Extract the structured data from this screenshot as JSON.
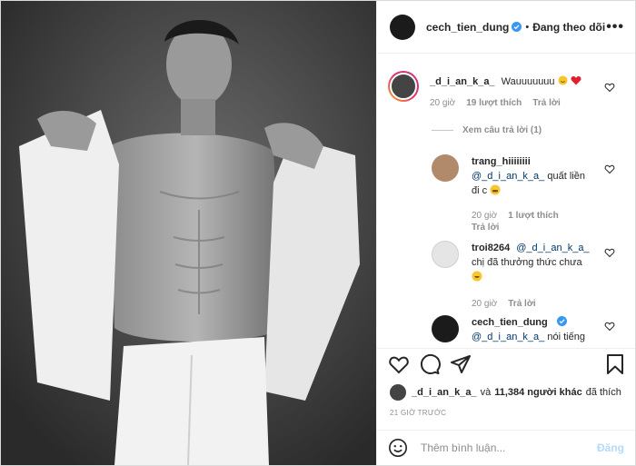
{
  "post": {
    "author": "cech_tien_dung",
    "follow_status": "Đang theo dõi",
    "more": "•••"
  },
  "comments": {
    "main": {
      "user": "_d_i_an_k_a_",
      "text": "Wauuuuuuu",
      "time": "20 giờ",
      "likes": "19 lượt thích",
      "reply": "Trả lời"
    },
    "view_replies": "Xem câu trả lời (1)",
    "replies": [
      {
        "user": "trang_hiiiiiiii",
        "mention": "@_d_i_an_k_a_",
        "text_a": "quất liền",
        "text_b": "đi c",
        "time": "20 giờ",
        "likes": "1 lượt thích",
        "reply": "Trả lời"
      },
      {
        "user": "troi8264",
        "mention": "@_d_i_an_k_a_",
        "text_a": "chị đã thưởng thức chưa",
        "time": "20 giờ",
        "reply": "Trả lời"
      },
      {
        "user": "cech_tien_dung",
        "mention": "@_d_i_an_k_a_",
        "text_a": "nói tiếng"
      }
    ]
  },
  "likes_line": {
    "user": "_d_i_an_k_a_",
    "and": "và",
    "count": "11,384 người khác",
    "suffix": "đã thích"
  },
  "time_ago": "21 GIỜ TRƯỚC",
  "add_comment": {
    "placeholder": "Thêm bình luận...",
    "post": "Đăng"
  },
  "colors": {
    "accent": "#0095f6",
    "heart": "#ed4956",
    "link": "#00376b"
  },
  "icons": [
    "verified-icon",
    "heart-icon",
    "comment-icon",
    "share-icon",
    "bookmark-icon",
    "emoji-icon"
  ]
}
